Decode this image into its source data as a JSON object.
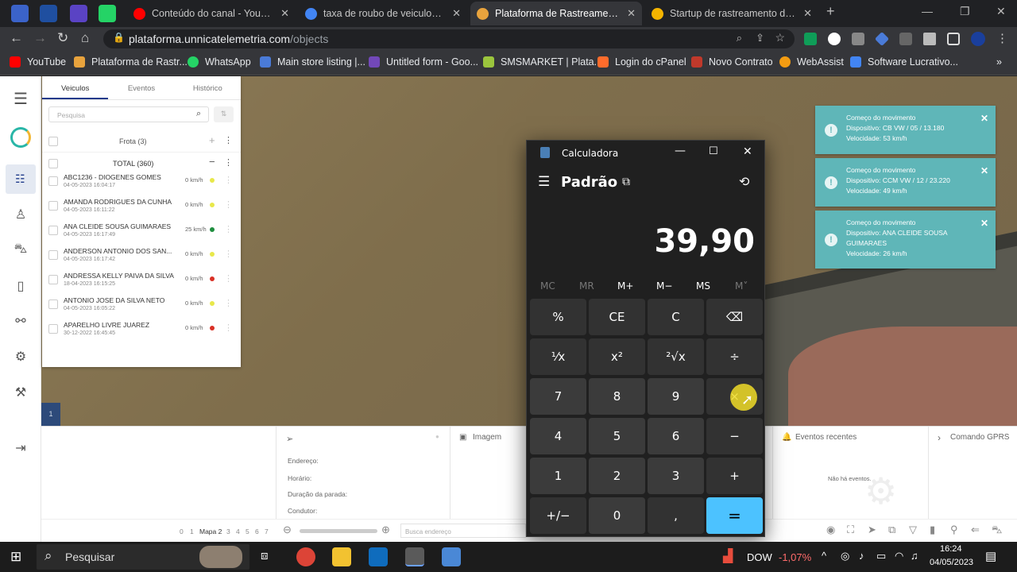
{
  "tabs": [
    {
      "title": "Conteúdo do canal - YouTube S",
      "color": "#ff0000"
    },
    {
      "title": "taxa de roubo de veiculos do b",
      "color": "#4285f4"
    },
    {
      "title": "Plataforma de Rastreamento e c",
      "color": "#e8a33d"
    },
    {
      "title": "Startup de rastreamento de frot",
      "color": "#f4b400"
    }
  ],
  "new_tab": "+",
  "address": {
    "host": "plataforma.unnicatelemetria.com",
    "path": "/objects"
  },
  "bookmarks": [
    "YouTube",
    "Plataforma de Rastr...",
    "WhatsApp",
    "Main store listing |...",
    "Untitled form - Goo...",
    "SMSMARKET | Plata...",
    "Login do cPanel",
    "Novo Contrato",
    "WebAssist",
    "Software Lucrativo..."
  ],
  "bookmarks_more": "»",
  "panel": {
    "tabs": [
      "Veiculos",
      "Eventos",
      "Histórico"
    ],
    "search_placeholder": "Pesquisa",
    "group": "Frota (3)",
    "total": "TOTAL (360)",
    "vehicles": [
      {
        "name": "ABC1236 - DIOGENES GOMES",
        "date": "04-05-2023 16:04:17",
        "speed": "0 km/h",
        "status": "#e8e84a"
      },
      {
        "name": "AMANDA RODRIGUES DA CUNHA",
        "date": "04-05-2023 16:11:22",
        "speed": "0 km/h",
        "status": "#e8e84a"
      },
      {
        "name": "ANA CLEIDE SOUSA GUIMARAES",
        "date": "04-05-2023 16:17:49",
        "speed": "25 km/h",
        "status": "#1e8e3e"
      },
      {
        "name": "ANDERSON ANTONIO DOS SAN...",
        "date": "04-05-2023 16:17:42",
        "speed": "0 km/h",
        "status": "#e8e84a"
      },
      {
        "name": "ANDRESSA KELLY PAIVA DA SILVA",
        "date": "18-04-2023 16:15:25",
        "speed": "0 km/h",
        "status": "#d93025"
      },
      {
        "name": "ANTONIO JOSE DA SILVA NETO",
        "date": "04-05-2023 16:05:22",
        "speed": "0 km/h",
        "status": "#e8e84a"
      },
      {
        "name": "APARELHO LIVRE JUAREZ",
        "date": "30-12-2022 16:45:45",
        "speed": "0 km/h",
        "status": "#d93025"
      }
    ]
  },
  "notifications": [
    {
      "title": "Começo do movimento",
      "device": "Dispositivo: CB VW / 05 / 13.180",
      "speed": "Velocidade: 53 km/h"
    },
    {
      "title": "Começo do movimento",
      "device": "Dispositivo: CCM VW / 12 / 23.220",
      "speed": "Velocidade: 49 km/h"
    },
    {
      "title": "Começo do movimento",
      "device": "Dispositivo: ANA CLEIDE SOUSA GUIMARAES",
      "speed": "Velocidade: 26 km/h"
    }
  ],
  "bottom": {
    "labels": [
      "Endereço:",
      "Horário:",
      "Duração da parada:",
      "Condutor:"
    ],
    "image": "Imagem",
    "events_title": "Eventos recentes",
    "no_events": "Não há eventos.",
    "gprs": "Comando GPRS",
    "map_pages": [
      "0",
      "1",
      "Mapa 2",
      "3",
      "4",
      "5",
      "6",
      "7"
    ],
    "search_address": "Busca endereço",
    "map_badge": "1"
  },
  "calculator": {
    "title": "Calculadora",
    "mode": "Padrão",
    "display": "39,90",
    "memory": [
      "MC",
      "MR",
      "M+",
      "M−",
      "MS",
      "M˅"
    ],
    "keys": [
      "%",
      "CE",
      "C",
      "⌫",
      "¹⁄x",
      "x²",
      "²√x",
      "÷",
      "7",
      "8",
      "9",
      "×",
      "4",
      "5",
      "6",
      "−",
      "1",
      "2",
      "3",
      "+",
      "+/−",
      "0",
      ",",
      "="
    ]
  },
  "taskbar": {
    "search": "Pesquisar",
    "stock": "DOW",
    "stock_change": "-1,07%",
    "time": "16:24",
    "date": "04/05/2023"
  }
}
